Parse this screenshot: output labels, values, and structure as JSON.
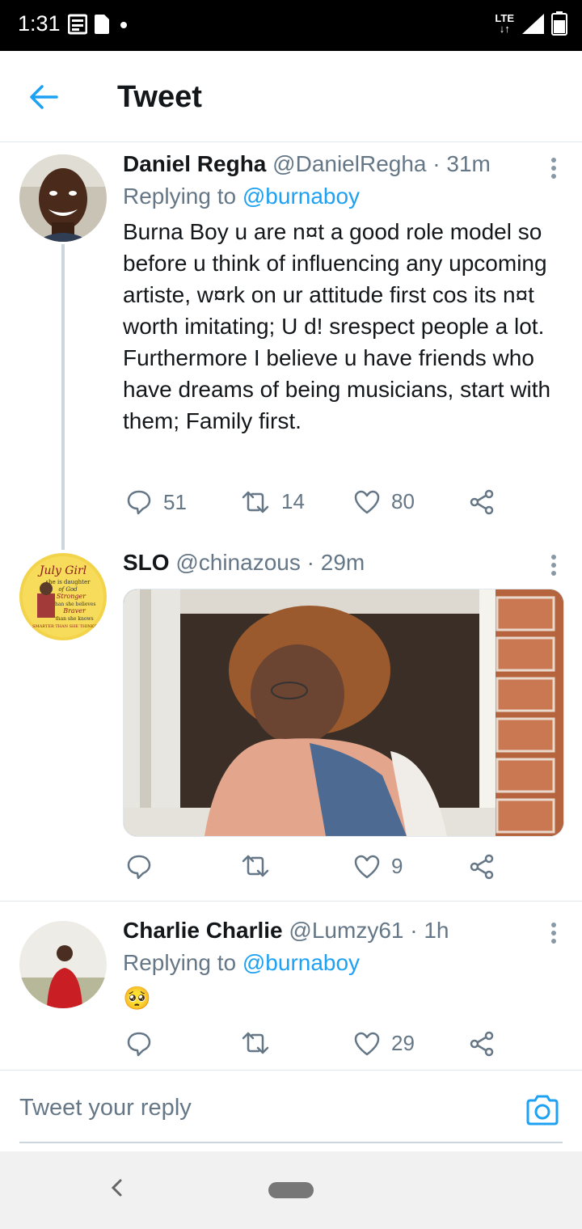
{
  "status_bar": {
    "time": "1:31",
    "network": "LTE"
  },
  "app_bar": {
    "title": "Tweet"
  },
  "tweets": [
    {
      "name": "Daniel Regha",
      "handle": "@DanielRegha",
      "time": "31m",
      "replying_label": "Replying to",
      "replying_to": "@burnaboy",
      "text": "Burna Boy u are n¤t a good role model so before u think of influencing any upcoming artiste, w¤rk on ur attitude first cos its n¤t worth imitating; U d! srespect people a lot. Furthermore I believe u have friends who have dreams of being musicians, start with them; Family first.",
      "replies": "51",
      "retweets": "14",
      "likes": "80"
    },
    {
      "name": "SLO",
      "handle": "@chinazous",
      "time": "29m",
      "avatar_text": [
        "July Girl",
        "she is daughter",
        "of God",
        "Stronger",
        "than she believes",
        "Braver",
        "than she knows",
        "SMARTER THAN SHE THINKS"
      ],
      "replies": "",
      "retweets": "",
      "likes": "9"
    },
    {
      "name": "Charlie Charlie",
      "handle": "@Lumzy61",
      "time": "1h",
      "replying_label": "Replying to",
      "replying_to": "@burnaboy",
      "text": "🥺",
      "replies": "",
      "retweets": "",
      "likes": "29"
    }
  ],
  "reply_bar": {
    "placeholder": "Tweet your reply"
  },
  "colors": {
    "accent": "#1da1f2",
    "secondary_text": "#657786",
    "divider": "#e1e8ed"
  }
}
